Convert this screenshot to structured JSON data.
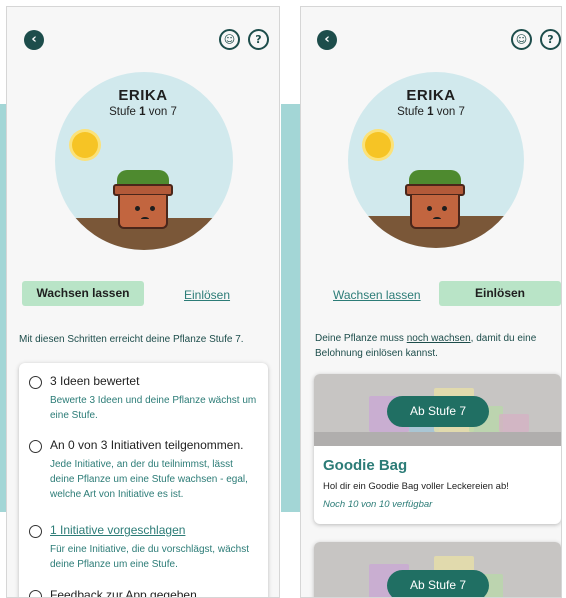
{
  "plant": {
    "name": "ERIKA",
    "level_prefix": "Stufe",
    "level_current": "1",
    "level_suffix": "von 7"
  },
  "icons": {
    "back": "back-arrow-icon",
    "profile": "user-circle-icon",
    "help": "help-circle-icon"
  },
  "tabs": {
    "grow": "Wachsen lassen",
    "redeem": "Einlösen"
  },
  "left_screen": {
    "intro": "Mit diesen Schritten erreicht deine Pflanze Stufe 7.",
    "steps": [
      {
        "title": "3 Ideen bewertet",
        "desc": "Bewerte 3 Ideen und deine Pflanze wächst um eine Stufe."
      },
      {
        "title": "An 0 von 3 Initiativen teilgenommen.",
        "desc": "Jede Initiative, an der du teilnimmst, lässt deine Pflanze um eine Stufe wachsen - egal, welche Art von Initiative es ist."
      },
      {
        "title": "1 Initiative vorgeschlagen",
        "desc": "Für eine Initiative, die du vorschlägst, wächst deine Pflanze um eine Stufe."
      },
      {
        "title": "Feedback zur App gegeben",
        "desc": ""
      }
    ]
  },
  "right_screen": {
    "intro_pre": "Deine Pflanze muss ",
    "intro_link": "noch wachsen",
    "intro_post": ", damit du eine Belohnung einlösen kannst.",
    "rewards": [
      {
        "badge": "Ab Stufe 7",
        "title": "Goodie Bag",
        "desc": "Hol dir ein Goodie Bag voller Leckereien ab!",
        "availability": "Noch 10 von 10 verfügbar"
      },
      {
        "badge": "Ab Stufe 7"
      }
    ]
  },
  "colors": {
    "accent_dark": "#1d4d4b",
    "accent_text": "#2c7c77",
    "tab_active": "#b9e4c7",
    "badge": "#206f63",
    "background_band": "#a3d6d6"
  }
}
